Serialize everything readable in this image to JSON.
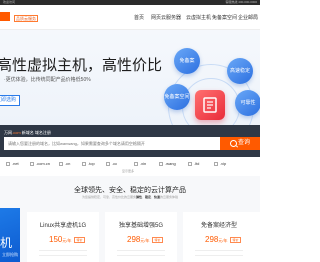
{
  "topbar": {
    "left_text": "欢迎访问",
    "right_text": "客服热线 400-000-0000"
  },
  "nav": {
    "slogan": "品质云服务",
    "items": [
      "首页",
      "网页云服务器",
      "云虚拟主机",
      "免备案空间",
      "企业邮局"
    ]
  },
  "banner": {
    "title": "高性虚拟主机，高性价比",
    "subtitle": "·更优体验，比传统同配产品价格低50%",
    "button_label": "立即选购",
    "bubbles": [
      "免备案",
      "高速稳定",
      "可靠性",
      "免备案空间"
    ],
    "slide_count": 3,
    "active_slide": 1
  },
  "search": {
    "label_prefix": "万网",
    "label_highlight": ".com",
    "label_suffix": " 新域名 域名注册",
    "placeholder": "请输入您要注册的域名，比如wanwang，如果需要查询多个域名请用空格隔开",
    "button_label": "查询"
  },
  "domains": {
    "suffixes": [
      ".net",
      ".com.cn",
      ".cn",
      ".top",
      ".cc",
      ".xin",
      ".wang",
      ".ltd",
      ".vip"
    ],
    "more": "显示更多"
  },
  "section": {
    "title": "全球领先、安全、稳定的云计算产品",
    "subtitle_parts": [
      "为您提供稳定、可靠、高性价比的云服务",
      "弹性",
      "、",
      "稳定",
      "、",
      "快速",
      "的云服务体验"
    ],
    "left_promo": {
      "big": "机",
      "small": "立即抢购"
    },
    "cards": [
      {
        "name": "Linux共享虚机1G",
        "price": "150",
        "unit": "元/年",
        "tag": "特价"
      },
      {
        "name": "独享基础增强5G",
        "price": "298",
        "unit": "元/年",
        "tag": "特价"
      },
      {
        "name": "免备案经济型",
        "price": "298",
        "unit": "元/年",
        "tag": "特价"
      }
    ]
  },
  "colors": {
    "accent": "#ff5a00",
    "brand_blue": "#2a7be9",
    "search_bg": "#2f3846"
  }
}
